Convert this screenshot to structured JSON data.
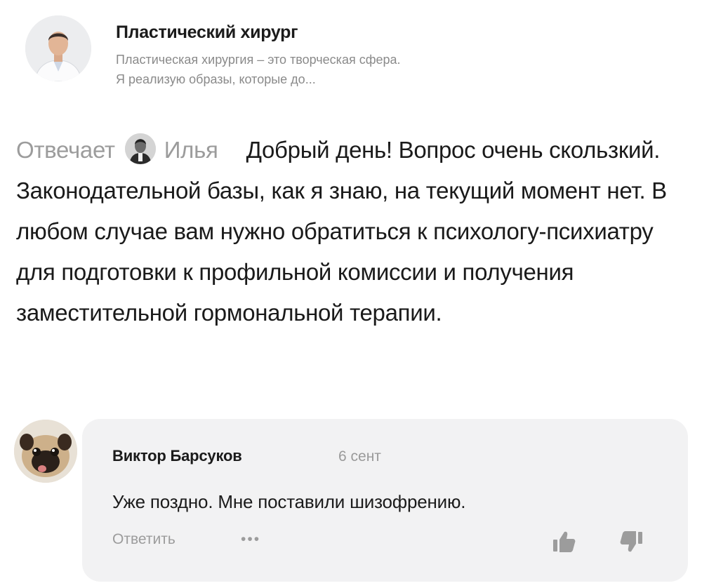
{
  "profile": {
    "name": "Пластический хирург",
    "description_line1": "Пластическая хирургия – это творческая сфера.",
    "description_line2": "Я реализую образы, которые до..."
  },
  "answer": {
    "label": "Отвечает",
    "author": "Илья",
    "text": "Добрый день! Вопрос очень скользкий. Законодательной базы, как я знаю, на текущий момент нет. В любом случае вам нужно обратиться к психологу-психиатру для подготовки к профильной комиссии и получения заместительной гормональной терапии."
  },
  "comment": {
    "author": "Виктор Барсуков",
    "date": "6 сент",
    "text": "Уже поздно. Мне поставили шизофрению.",
    "reply_label": "Ответить",
    "more_label": "•••",
    "like_icon": "thumbs-up-icon",
    "dislike_icon": "thumbs-down-icon"
  },
  "colors": {
    "muted": "#9c9c9c",
    "card_bg": "#f2f2f3",
    "text": "#1a1a1a"
  }
}
